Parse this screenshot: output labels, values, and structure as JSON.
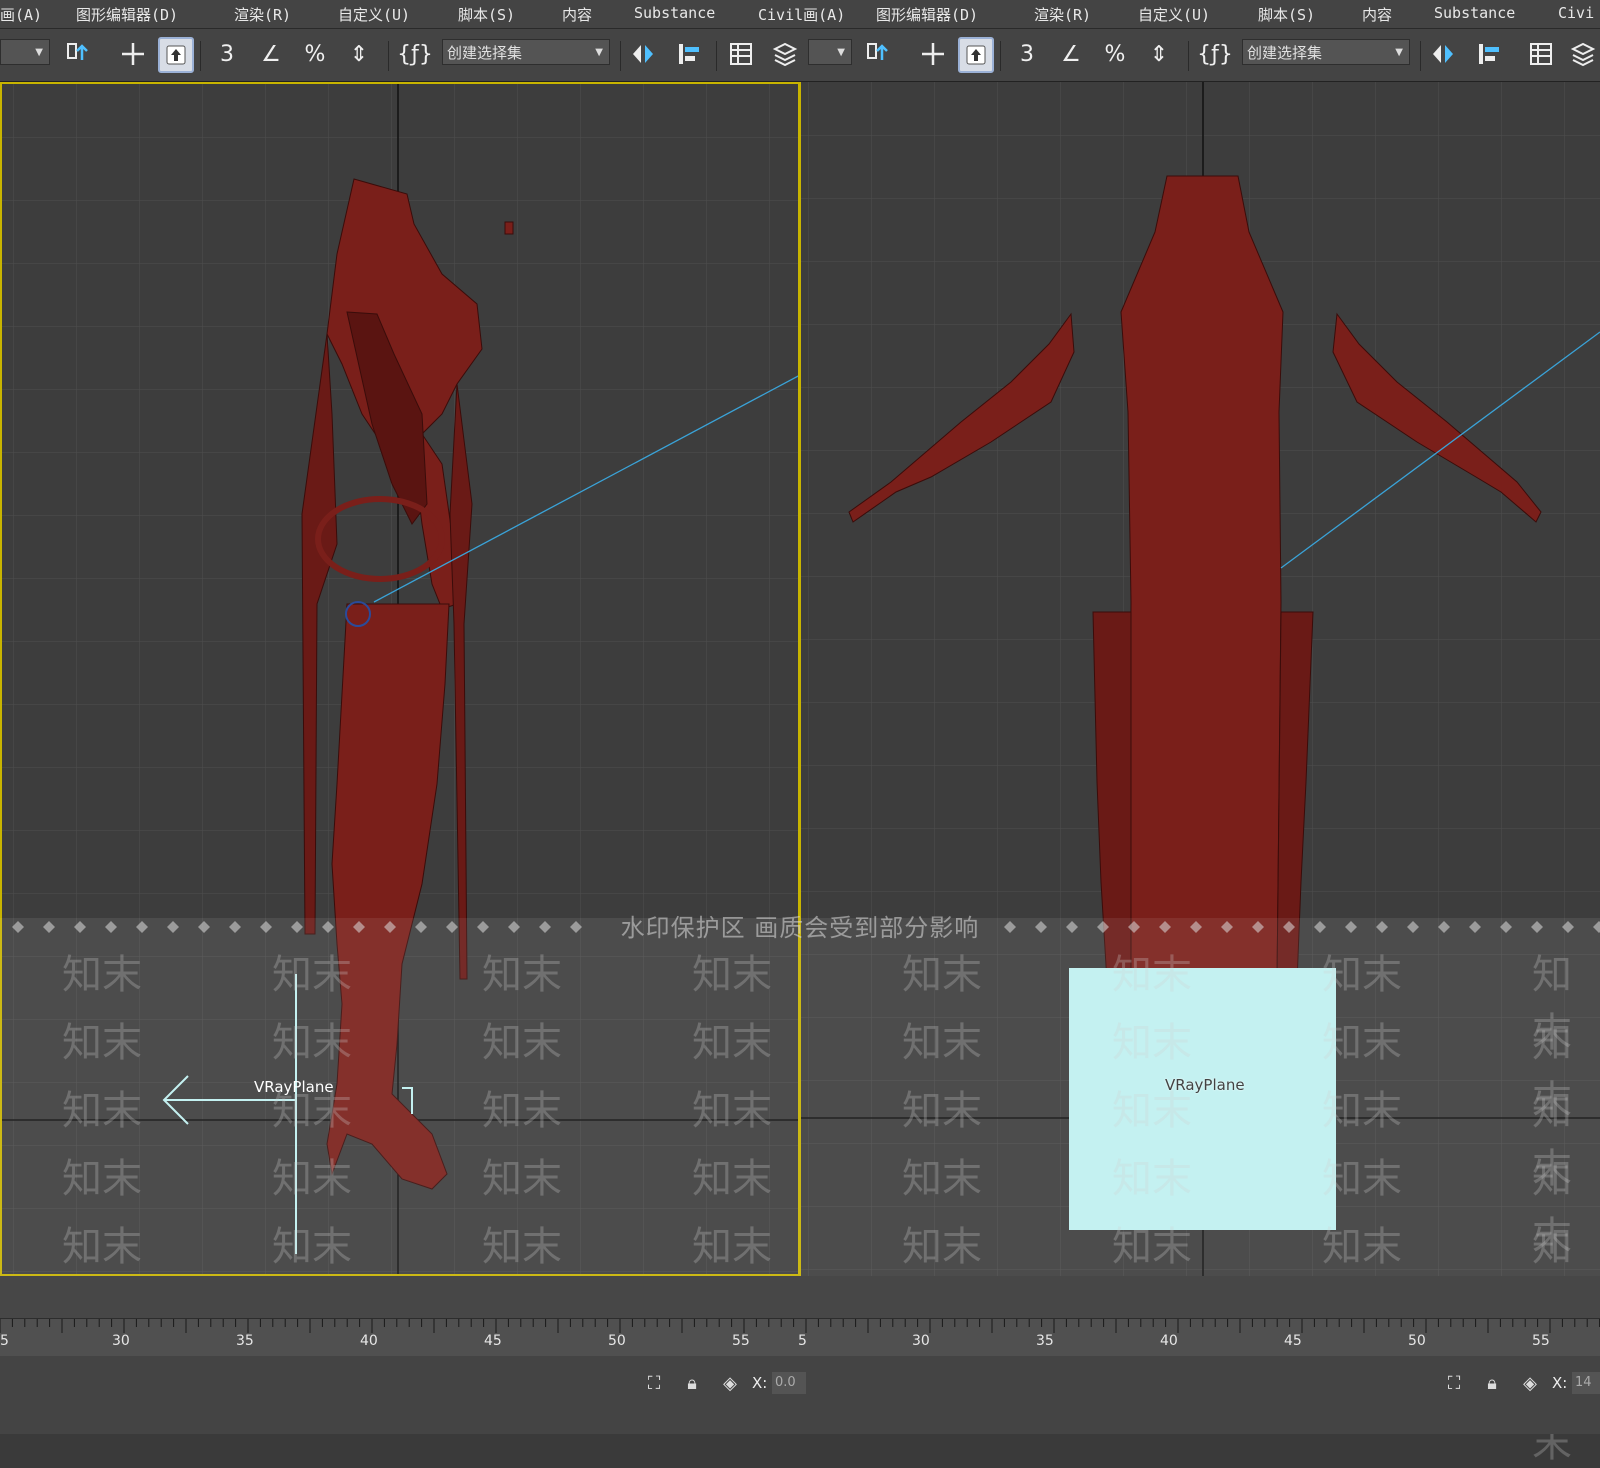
{
  "menu": {
    "left": [
      "画(A)",
      "图形编辑器(D)",
      "渲染(R)",
      "自定义(U)",
      "脚本(S)",
      "内容",
      "Substance",
      "Civil画(A)"
    ],
    "right": [
      "图形编辑器(D)",
      "渲染(R)",
      "自定义(U)",
      "脚本(S)",
      "内容",
      "Substance",
      "Civi"
    ]
  },
  "toolbar": {
    "selection_set_left": "创建选择集",
    "selection_set_right": "创建选择集",
    "snaps": {
      "snap3": "3",
      "angle": "∠",
      "percent": "%",
      "spinner": "⇕"
    }
  },
  "viewport_left": {
    "object_label": "VRayPlane"
  },
  "viewport_right": {
    "object_label": "VRayPlane"
  },
  "watermark": {
    "banner": "水印保护区  画质会受到部分影响",
    "mark": "知末"
  },
  "timeline": {
    "left_ticks": [
      "5",
      "30",
      "35",
      "40",
      "45",
      "50",
      "55"
    ],
    "right_ticks": [
      "5",
      "30",
      "35",
      "40",
      "45",
      "50",
      "55"
    ]
  },
  "status": {
    "left_x_label": "X:",
    "left_x_value": "0.0",
    "right_x_label": "X:",
    "right_x_value": "14"
  },
  "colors": {
    "viewport_bg": "#3d3d3d",
    "active_border": "#c8b400",
    "mesh": "#7a1f1a",
    "vray_plane": "#bff0f0",
    "helper_line": "#3aa3d8"
  }
}
